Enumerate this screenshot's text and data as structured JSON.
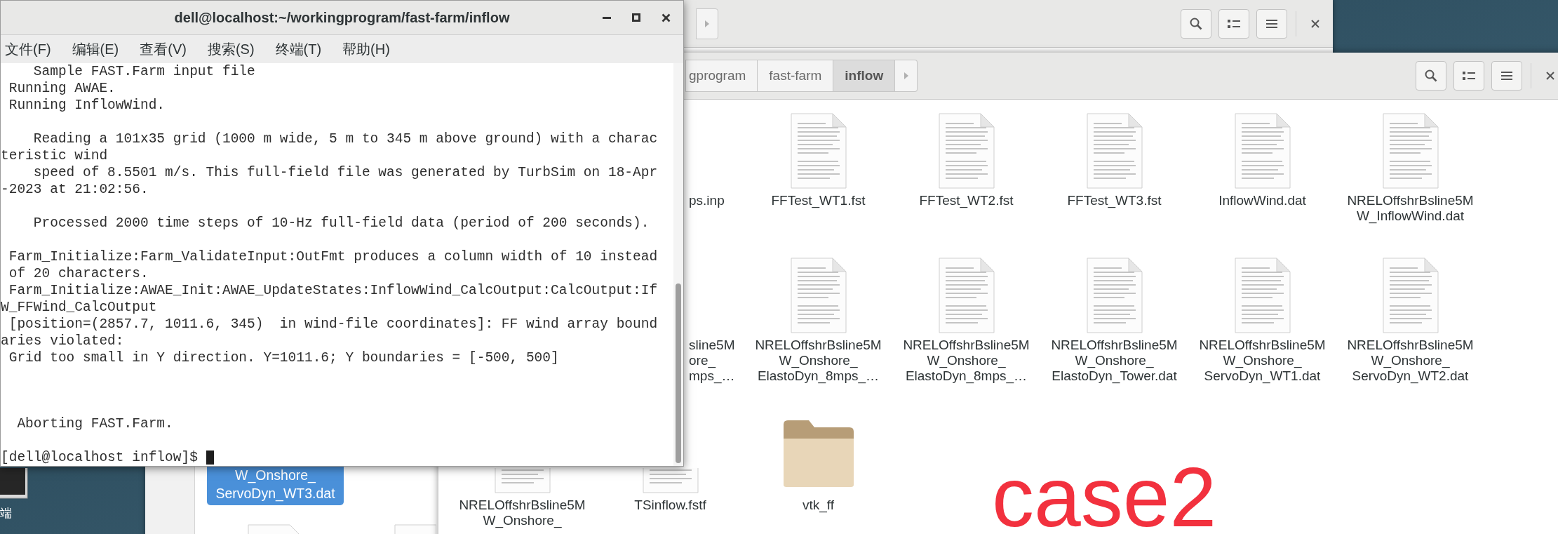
{
  "terminal": {
    "title": "dell@localhost:~/workingprogram/fast-farm/inflow",
    "menu": [
      "文件(F)",
      "编辑(E)",
      "查看(V)",
      "搜索(S)",
      "终端(T)",
      "帮助(H)"
    ],
    "blocks": [
      [
        "    Sample FAST.Farm input file",
        " Running AWAE.",
        " Running InflowWind."
      ],
      [
        "    Reading a 101x35 grid (1000 m wide, 5 m to 345 m above ground) with a charac",
        "teristic wind",
        "    speed of 8.5501 m/s. This full-field file was generated by TurbSim on 18-Apr",
        "-2023 at 21:02:56."
      ],
      [
        "    Processed 2000 time steps of 10-Hz full-field data (period of 200 seconds)."
      ],
      [
        " Farm_Initialize:Farm_ValidateInput:OutFmt produces a column width of 10 instead",
        " of 20 characters.",
        " Farm_Initialize:AWAE_Init:AWAE_UpdateStates:InflowWind_CalcOutput:CalcOutput:If",
        "W_FFWind_CalcOutput",
        " [position=(2857.7, 1011.6, 345)  in wind-file coordinates]: FF wind array bound",
        "aries violated:",
        " Grid too small in Y direction. Y=1011.6; Y boundaries = [-500, 500]"
      ],
      [
        "  Aborting FAST.Farm."
      ]
    ],
    "prompt": "[dell@localhost inflow]$ "
  },
  "back_window": {
    "items": [
      {
        "lines": [
          "W_Onshore_",
          "ServoDyn_WT3.dat"
        ],
        "selected": true
      }
    ]
  },
  "front_window": {
    "breadcrumbs": [
      {
        "label": "gprogram",
        "selected": false
      },
      {
        "label": "fast-farm",
        "selected": false
      },
      {
        "label": "inflow",
        "selected": true
      }
    ],
    "rows": [
      {
        "items": [
          {
            "kind": "file_hidden",
            "partial": true,
            "lines": [
              "ps.inp"
            ],
            "selected": false
          },
          {
            "kind": "file",
            "partial": false,
            "lines": [
              "FFTest_WT1.fst"
            ],
            "selected": false
          },
          {
            "kind": "file",
            "partial": false,
            "lines": [
              "FFTest_WT2.fst"
            ],
            "selected": false
          },
          {
            "kind": "file",
            "partial": false,
            "lines": [
              "FFTest_WT3.fst"
            ],
            "selected": false
          },
          {
            "kind": "file",
            "partial": false,
            "lines": [
              "InflowWind.dat"
            ],
            "selected": false
          },
          {
            "kind": "file",
            "partial": false,
            "lines": [
              "NRELOffshrBsline5M",
              "W_InflowWind.dat"
            ],
            "selected": false
          }
        ]
      },
      {
        "items": [
          {
            "kind": "file_hidden",
            "partial": true,
            "lines": [
              "sline5M",
              "ore_",
              "mps_…"
            ],
            "selected": false
          },
          {
            "kind": "file",
            "partial": false,
            "lines": [
              "NRELOffshrBsline5M",
              "W_Onshore_",
              "ElastoDyn_8mps_…"
            ],
            "selected": false
          },
          {
            "kind": "file",
            "partial": false,
            "lines": [
              "NRELOffshrBsline5M",
              "W_Onshore_",
              "ElastoDyn_8mps_…"
            ],
            "selected": false
          },
          {
            "kind": "file",
            "partial": false,
            "lines": [
              "NRELOffshrBsline5M",
              "W_Onshore_",
              "ElastoDyn_Tower.dat"
            ],
            "selected": false
          },
          {
            "kind": "file",
            "partial": false,
            "lines": [
              "NRELOffshrBsline5M",
              "W_Onshore_",
              "ServoDyn_WT1.dat"
            ],
            "selected": false
          },
          {
            "kind": "file",
            "partial": false,
            "lines": [
              "NRELOffshrBsline5M",
              "W_Onshore_",
              "ServoDyn_WT2.dat"
            ],
            "selected": false
          }
        ]
      },
      {
        "items": [
          {
            "kind": "file_cut",
            "partial": false,
            "lines": [
              "NRELOffshrBsline5M",
              "W_Onshore_"
            ],
            "selected": false
          },
          {
            "kind": "file_cut",
            "partial": false,
            "lines": [
              "TSinflow.fstf"
            ],
            "selected": false
          },
          {
            "kind": "folder",
            "partial": false,
            "lines": [
              "vtk_ff"
            ],
            "selected": false
          }
        ]
      }
    ]
  },
  "desktop": {
    "icon_label": "端"
  },
  "annotation": "case2"
}
